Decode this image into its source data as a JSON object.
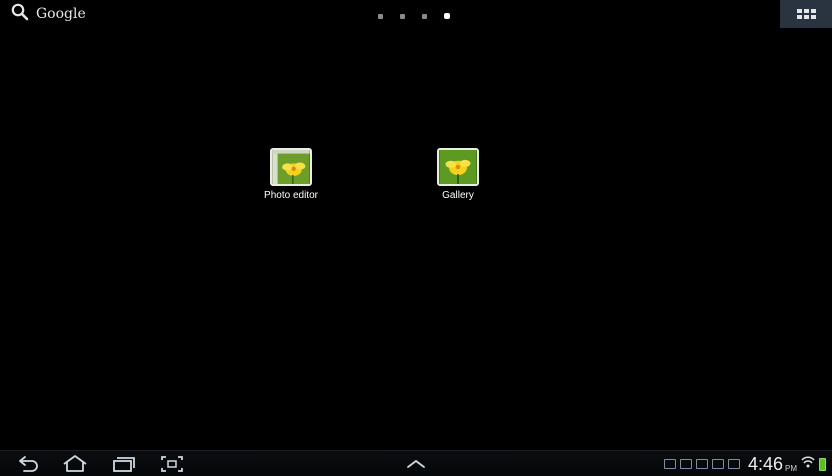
{
  "top_bar": {
    "search_label": "Google",
    "page_count": 4,
    "active_page": 4
  },
  "desktop": {
    "apps": [
      {
        "label": "Photo editor",
        "icon": "photo-editor-icon"
      },
      {
        "label": "Gallery",
        "icon": "gallery-icon"
      }
    ]
  },
  "nav_bar": {
    "buttons": [
      "back-icon",
      "home-icon",
      "recent-apps-icon",
      "screenshot-icon",
      "up-chevron-icon"
    ],
    "status": {
      "time": "4:46",
      "ampm": "PM"
    }
  },
  "colors": {
    "background": "#000000",
    "apps_button_bg": "#2a3340",
    "battery": "#59c022"
  }
}
